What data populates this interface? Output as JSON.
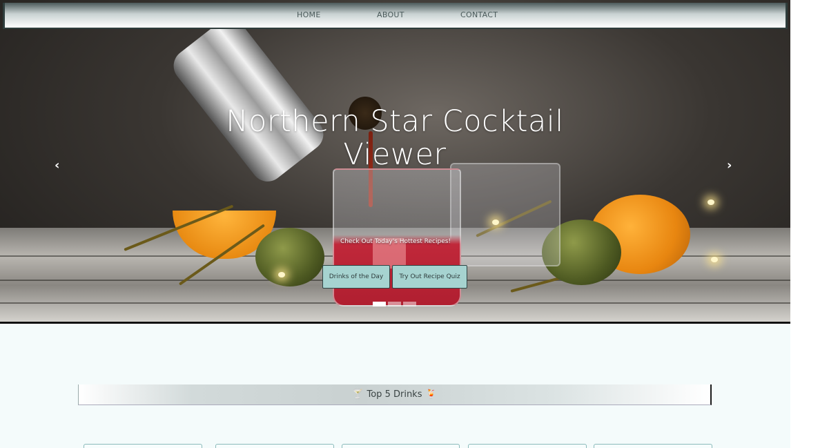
{
  "nav": {
    "home": "HOME",
    "about": "ABOUT",
    "contact": "CONTACT"
  },
  "hero": {
    "title": "Northern Star Cocktail Viewer",
    "subtitle": "Check Out Today's Hottest Recipes!",
    "buttons": {
      "drinks": "Drinks of the Day",
      "quiz": "Try Out Recipe Quiz"
    },
    "prev_icon": "‹",
    "next_icon": "›",
    "slides_count": 3,
    "active_slide": 1
  },
  "top5": {
    "label": "Top 5 Drinks",
    "left_icon": "🍸",
    "right_icon": "🍹"
  },
  "colors": {
    "accent": "#a6d3d0",
    "page_bg": "#f4fbfb",
    "nav_border": "#2e3d3c"
  }
}
